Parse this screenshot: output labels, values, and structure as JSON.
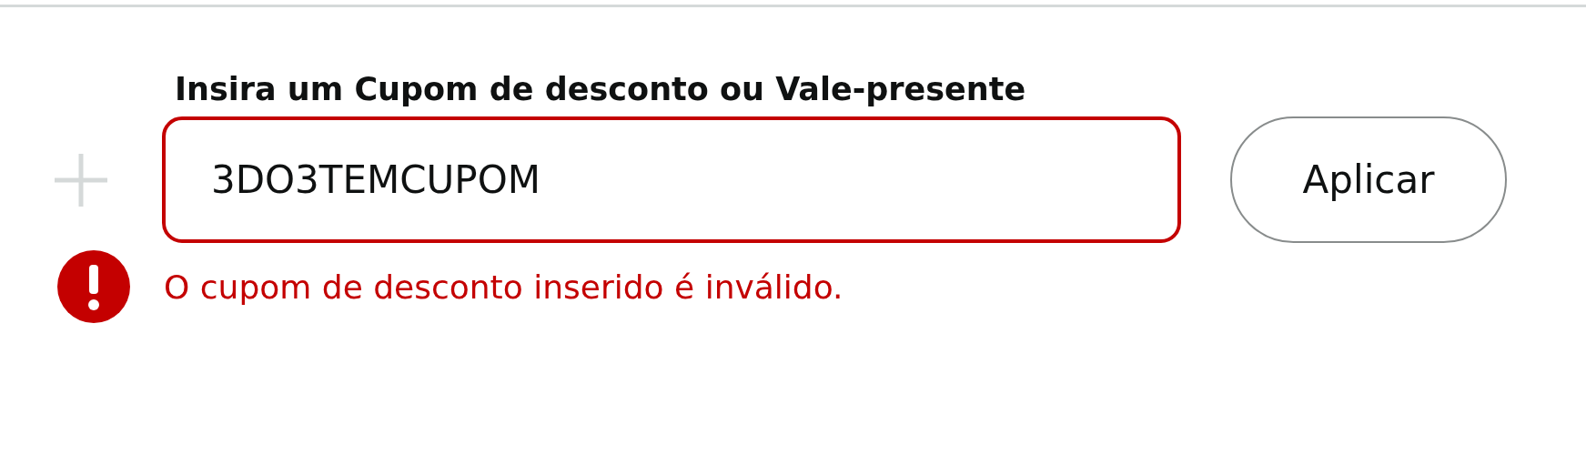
{
  "coupon": {
    "heading": "Insira um Cupom de desconto ou Vale-presente",
    "field": {
      "value": "3DO3TEMCUPOM",
      "invalid": true
    },
    "button": "Aplicar",
    "error": "O cupom de desconto inserido é inválido."
  }
}
